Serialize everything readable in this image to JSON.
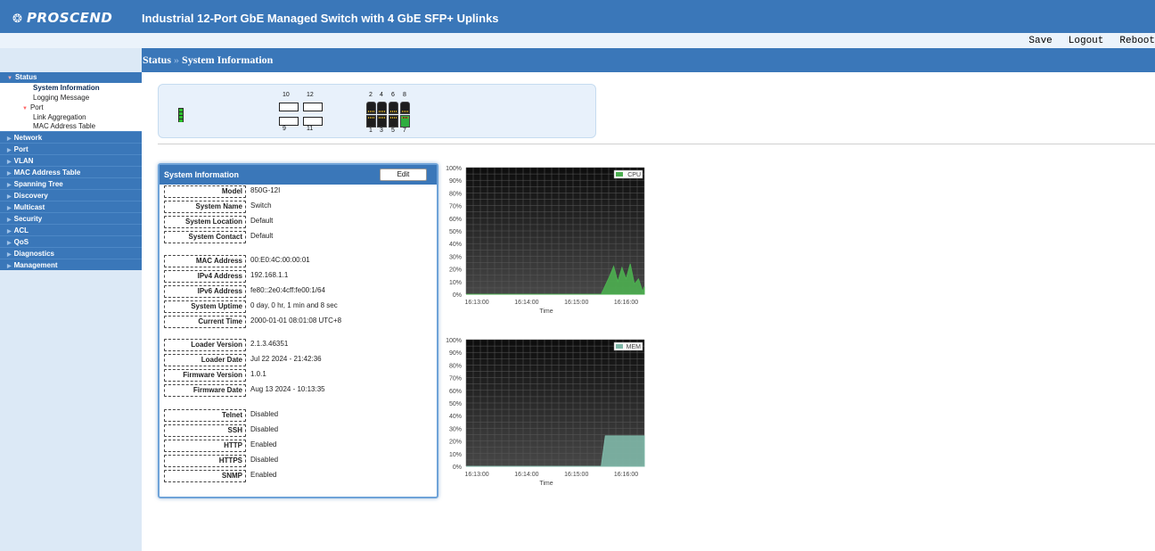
{
  "header": {
    "logo": "PROSCEND",
    "product_title": "Industrial 12-Port GbE Managed Switch with 4 GbE SFP+ Uplinks",
    "links": [
      "Save",
      "Logout",
      "Reboot"
    ]
  },
  "breadcrumb": {
    "parent": "Status",
    "separator": "»",
    "current": "System Information"
  },
  "sidebar": {
    "status": "Status",
    "status_items": [
      "System Information",
      "Logging Message"
    ],
    "port": "Port",
    "port_items": [
      "Link Aggregation",
      "MAC Address Table"
    ],
    "items": [
      "Network",
      "Port",
      "VLAN",
      "MAC Address Table",
      "Spanning Tree",
      "Discovery",
      "Multicast",
      "Security",
      "ACL",
      "QoS",
      "Diagnostics",
      "Management"
    ]
  },
  "port_panel": {
    "sfp_top": [
      "10",
      "12"
    ],
    "sfp_bottom": [
      "9",
      "11"
    ],
    "rj45_top": [
      "2",
      "4",
      "6",
      "8"
    ],
    "rj45_bottom": [
      "1",
      "3",
      "5",
      "7"
    ],
    "link_up_ports": [
      "7"
    ]
  },
  "system_info": {
    "title": "System Information",
    "edit_label": "Edit",
    "groups": [
      [
        {
          "label": "Model",
          "value": "850G-12I"
        },
        {
          "label": "System Name",
          "value": "Switch"
        },
        {
          "label": "System Location",
          "value": "Default"
        },
        {
          "label": "System Contact",
          "value": "Default"
        }
      ],
      [
        {
          "label": "MAC Address",
          "value": "00:E0:4C:00:00:01"
        },
        {
          "label": "IPv4 Address",
          "value": "192.168.1.1"
        },
        {
          "label": "IPv6 Address",
          "value": "fe80::2e0:4cff:fe00:1/64"
        },
        {
          "label": "System Uptime",
          "value": "0 day, 0 hr, 1 min and 8 sec"
        },
        {
          "label": "Current Time",
          "value": "2000-01-01 08:01:08 UTC+8"
        }
      ],
      [
        {
          "label": "Loader Version",
          "value": "2.1.3.46351"
        },
        {
          "label": "Loader Date",
          "value": "Jul 22 2024 - 21:42:36"
        },
        {
          "label": "Firmware Version",
          "value": "1.0.1"
        },
        {
          "label": "Firmware Date",
          "value": "Aug 13 2024 - 10:13:35"
        }
      ],
      [
        {
          "label": "Telnet",
          "value": "Disabled"
        },
        {
          "label": "SSH",
          "value": "Disabled"
        },
        {
          "label": "HTTP",
          "value": "Enabled"
        },
        {
          "label": "HTTPS",
          "value": "Disabled"
        },
        {
          "label": "SNMP",
          "value": "Enabled"
        }
      ]
    ]
  },
  "chart_data": [
    {
      "type": "area",
      "series": [
        {
          "name": "CPU",
          "color": "#4caf50",
          "x": [
            "16:12:47",
            "16:14:20",
            "16:15:30",
            "16:15:40",
            "16:15:45",
            "16:15:50",
            "16:15:55",
            "16:16:00",
            "16:16:05",
            "16:16:10",
            "16:16:15",
            "16:16:20",
            "16:16:22"
          ],
          "values": [
            0,
            0,
            0,
            14,
            22,
            10,
            21,
            12,
            24,
            8,
            12,
            2,
            6
          ]
        }
      ],
      "x_tick_labels": [
        "16:13:00",
        "16:14:00",
        "16:15:00",
        "16:16:00"
      ],
      "xlabel": "Time",
      "ylim": [
        0,
        100
      ],
      "y_tick_labels": [
        "0%",
        "10%",
        "20%",
        "30%",
        "40%",
        "50%",
        "60%",
        "70%",
        "80%",
        "90%",
        "100%"
      ],
      "legend_position": "top-right",
      "grid": true
    },
    {
      "type": "area",
      "series": [
        {
          "name": "MEM",
          "color": "#7fb8a8",
          "x": [
            "16:12:47",
            "16:15:10",
            "16:15:30",
            "16:15:35",
            "16:16:22"
          ],
          "values": [
            0,
            0,
            0,
            24,
            24
          ]
        }
      ],
      "x_tick_labels": [
        "16:13:00",
        "16:14:00",
        "16:15:00",
        "16:16:00"
      ],
      "xlabel": "Time",
      "ylim": [
        0,
        100
      ],
      "y_tick_labels": [
        "0%",
        "10%",
        "20%",
        "30%",
        "40%",
        "50%",
        "60%",
        "70%",
        "80%",
        "90%",
        "100%"
      ],
      "legend_position": "top-right",
      "grid": true
    }
  ]
}
